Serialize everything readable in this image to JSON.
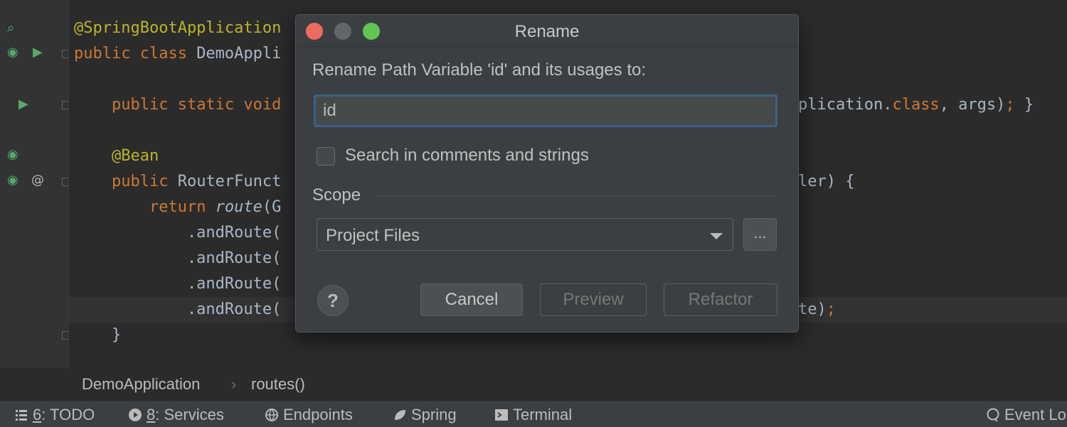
{
  "editor": {
    "lines": [
      {
        "parts": [
          {
            "t": "@SpringBootApplication",
            "c": "ann"
          }
        ]
      },
      {
        "parts": [
          {
            "t": "public class ",
            "c": "kw"
          },
          {
            "t": "DemoAppli",
            "c": ""
          }
        ]
      },
      {
        "parts": [
          {
            "t": "    "
          },
          {
            "t": "public static void",
            "c": "kw"
          }
        ]
      },
      {
        "parts": [
          {
            "t": "    "
          },
          {
            "t": "@Bean",
            "c": "ann"
          }
        ]
      },
      {
        "parts": [
          {
            "t": "    "
          },
          {
            "t": "public ",
            "c": "kw"
          },
          {
            "t": "RouterFunct",
            "c": ""
          }
        ]
      },
      {
        "parts": [
          {
            "t": "        "
          },
          {
            "t": "return ",
            "c": "kw"
          },
          {
            "t": "route",
            "c": "it"
          },
          {
            "t": "(G",
            "c": ""
          }
        ]
      },
      {
        "parts": [
          {
            "t": "            .andRoute(",
            "c": ""
          }
        ]
      },
      {
        "parts": [
          {
            "t": "            .andRoute(",
            "c": ""
          }
        ]
      },
      {
        "parts": [
          {
            "t": "            .andRoute(",
            "c": ""
          }
        ]
      },
      {
        "parts": [
          {
            "t": "            .andRoute(",
            "c": ""
          }
        ]
      },
      {
        "parts": [
          {
            "t": "    }",
            "c": ""
          }
        ]
      }
    ],
    "right_fragments": [
      {
        "parts": [
          {
            "t": "plication.",
            "c": ""
          },
          {
            "t": "class",
            "c": "kw"
          },
          {
            "t": ", args)",
            "c": ""
          },
          {
            "t": ";",
            "c": "kw"
          },
          {
            "t": " }",
            "c": ""
          }
        ]
      },
      {
        "parts": [
          {
            "t": "ler) {",
            "c": ""
          }
        ]
      },
      {
        "parts": [
          {
            "t": "te)",
            "c": ""
          },
          {
            "t": ";",
            "c": "kw"
          }
        ]
      }
    ]
  },
  "breadcrumb": {
    "items": [
      "DemoApplication",
      "routes()"
    ],
    "separator": "›"
  },
  "statusbar": {
    "items": [
      {
        "num": "6",
        "label": ": TODO",
        "icon": "todo-list-icon"
      },
      {
        "num": "8",
        "label": ": Services",
        "icon": "services-play-icon"
      },
      {
        "num": "",
        "label": "Endpoints",
        "icon": "endpoints-globe-icon"
      },
      {
        "num": "",
        "label": "Spring",
        "icon": "spring-leaf-icon"
      },
      {
        "num": "",
        "label": "Terminal",
        "icon": "terminal-icon"
      },
      {
        "num": "",
        "label": "Event Lo",
        "icon": "event-log-icon"
      }
    ]
  },
  "dialog": {
    "title": "Rename",
    "prompt": "Rename Path Variable 'id' and its usages to:",
    "new_name": "id",
    "search_checkbox_label": "Search in comments and strings",
    "search_checked": false,
    "scope_label": "Scope",
    "scope_value": "Project Files",
    "ellipsis_label": "...",
    "help_label": "?",
    "cancel_label": "Cancel",
    "preview_label": "Preview",
    "refactor_label": "Refactor"
  },
  "colors": {
    "accent_focus": "#3d6185",
    "selection": "#214283",
    "keyword": "#cc7832",
    "annotation": "#bbb529"
  }
}
